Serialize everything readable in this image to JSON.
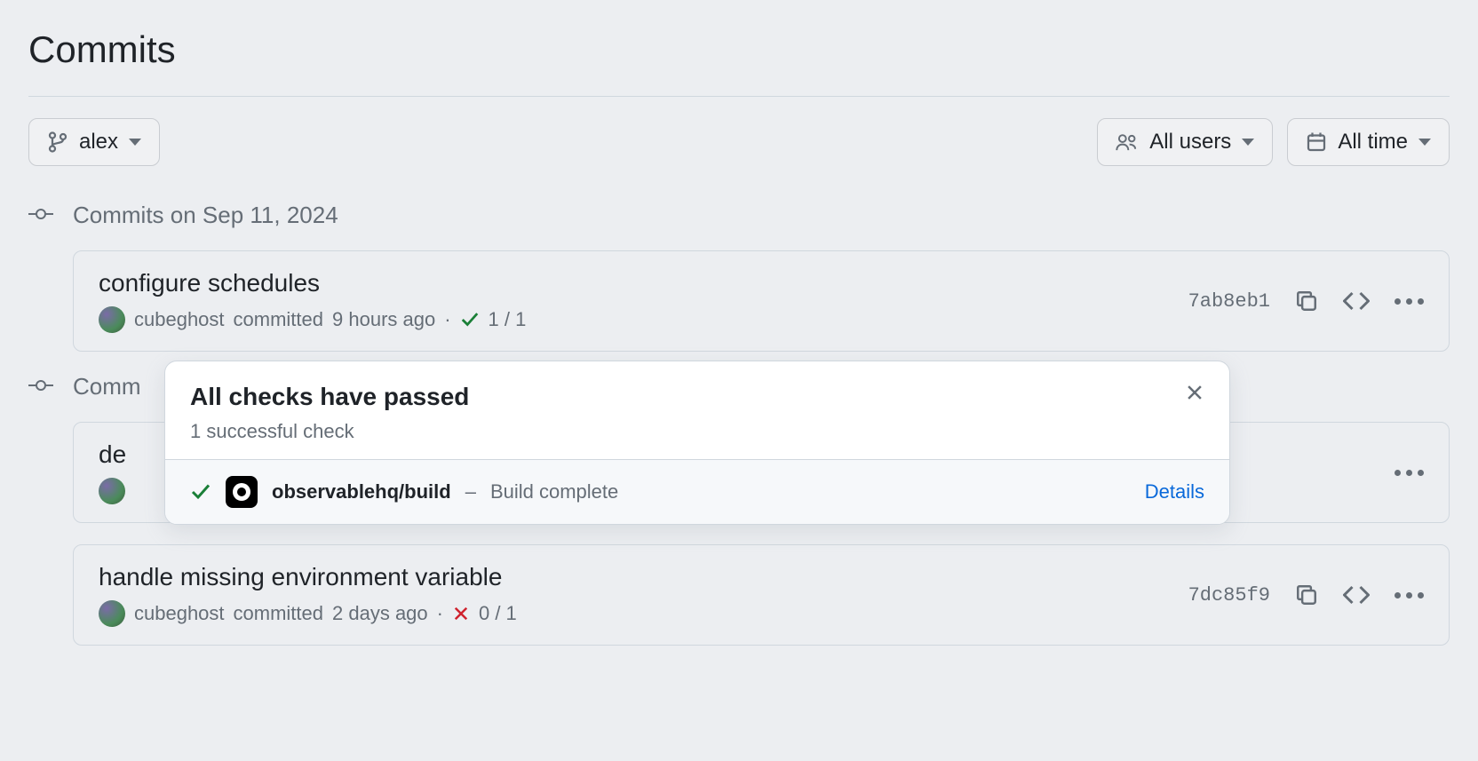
{
  "page": {
    "title": "Commits"
  },
  "filters": {
    "branch": "alex",
    "users": "All users",
    "time": "All time"
  },
  "groups": [
    {
      "date_label": "Commits on Sep 11, 2024",
      "commits": [
        {
          "title": "configure schedules",
          "author": "cubeghost",
          "time": "9 hours ago",
          "committed_word": "committed",
          "status": "pass",
          "status_text": "1 / 1",
          "sha": "7ab8eb1"
        }
      ]
    },
    {
      "date_label": "Comm",
      "commits": [
        {
          "title": "de",
          "author": "",
          "time": "",
          "committed_word": "",
          "status": "none",
          "status_text": "",
          "sha": ""
        },
        {
          "title": "handle missing environment variable",
          "author": "cubeghost",
          "time": "2 days ago",
          "committed_word": "committed",
          "status": "fail",
          "status_text": "0 / 1",
          "sha": "7dc85f9"
        }
      ]
    }
  ],
  "popover": {
    "title": "All checks have passed",
    "subtitle": "1 successful check",
    "check_name": "observablehq/build",
    "check_separator": "–",
    "check_message": "Build complete",
    "details_label": "Details"
  }
}
